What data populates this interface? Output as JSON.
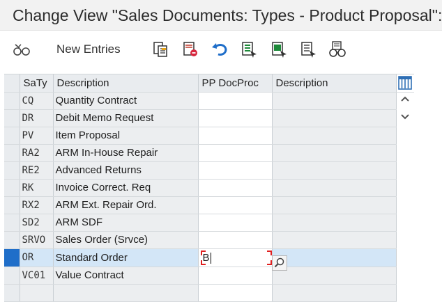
{
  "window": {
    "title": "Change View \"Sales Documents: Types - Product Proposal\": O"
  },
  "toolbar": {
    "new_entries_label": "New Entries",
    "icons": [
      "display-change-icon",
      "copy-icon",
      "delete-icon",
      "undo-icon",
      "select-all-icon",
      "select-block-icon",
      "deselect-all-icon",
      "other-view-icon"
    ]
  },
  "grid": {
    "columns": [
      "SaTy",
      "Description",
      "PP DocProc",
      "Description"
    ],
    "rows": [
      {
        "saty": "CQ",
        "description": "Quantity Contract",
        "pp_docproc": "",
        "description2": ""
      },
      {
        "saty": "DR",
        "description": "Debit Memo Request",
        "pp_docproc": "",
        "description2": ""
      },
      {
        "saty": "PV",
        "description": "Item Proposal",
        "pp_docproc": "",
        "description2": ""
      },
      {
        "saty": "RA2",
        "description": "ARM In-House Repair",
        "pp_docproc": "",
        "description2": ""
      },
      {
        "saty": "RE2",
        "description": "Advanced Returns",
        "pp_docproc": "",
        "description2": ""
      },
      {
        "saty": "RK",
        "description": "Invoice Correct. Req",
        "pp_docproc": "",
        "description2": ""
      },
      {
        "saty": "RX2",
        "description": "ARM Ext. Repair Ord.",
        "pp_docproc": "",
        "description2": ""
      },
      {
        "saty": "SD2",
        "description": "ARM SDF",
        "pp_docproc": "",
        "description2": ""
      },
      {
        "saty": "SRVO",
        "description": "Sales Order (Srvce)",
        "pp_docproc": "",
        "description2": ""
      },
      {
        "saty": "OR",
        "description": "Standard Order",
        "pp_docproc": "B",
        "description2": ""
      },
      {
        "saty": "VC01",
        "description": "Value Contract",
        "pp_docproc": "",
        "description2": ""
      }
    ],
    "current_row_index": 9
  },
  "colors": {
    "selection_active": "#1f6ec9",
    "current_row": "#d3e6f7",
    "input_focus_corner": "#e02020"
  }
}
